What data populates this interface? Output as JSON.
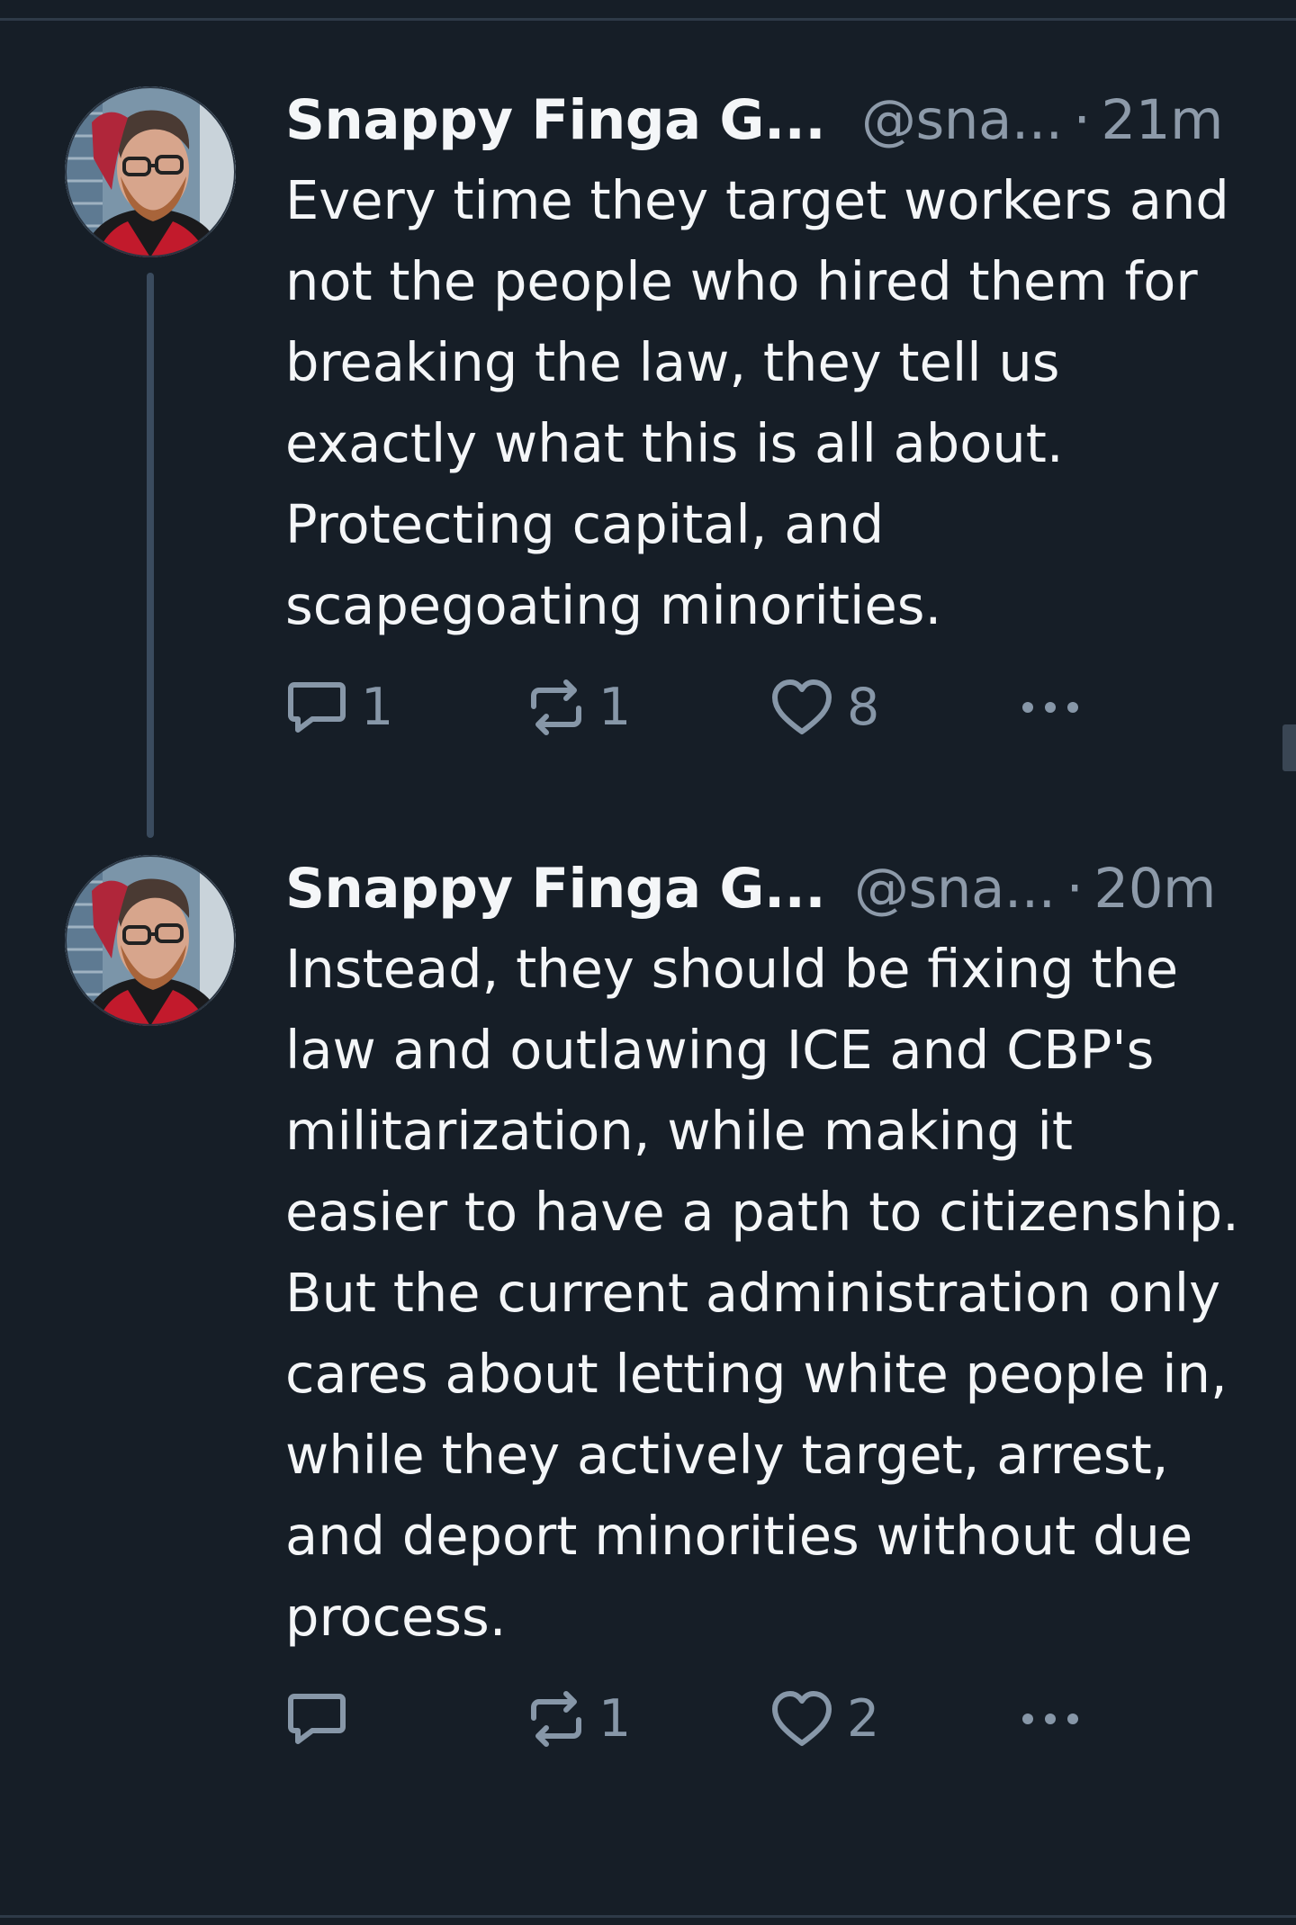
{
  "theme": {
    "background": "#161e27",
    "text": "#f4f6f8",
    "muted": "#8d9aa9",
    "icon": "#8797a8",
    "thread_line": "#3a4b5e"
  },
  "posts": [
    {
      "display_name": "Snappy Finga G...",
      "handle": "@sna...",
      "separator": "·",
      "time": "21m",
      "text": "Every time they target workers and not the people who hired them for breaking the law, they tell us exactly what this is all about.  Protecting capital, and scapegoating minorities.",
      "replies": "1",
      "reposts": "1",
      "likes": "8",
      "avatar_icon": "profile-photo"
    },
    {
      "display_name": "Snappy Finga G...",
      "handle": "@sna...",
      "separator": "·",
      "time": "20m",
      "text": "Instead, they should be fixing the law and outlawing ICE and CBP's militarization, while making it easier to have a path to citizenship.  But the current administration only cares about letting white people in, while they actively target, arrest, and deport minorities without due process.",
      "replies": "",
      "reposts": "1",
      "likes": "2",
      "avatar_icon": "profile-photo"
    }
  ],
  "icons": {
    "reply": "reply-bubble-icon",
    "repost": "repost-arrows-icon",
    "like": "heart-icon",
    "more": "more-dots-icon"
  }
}
